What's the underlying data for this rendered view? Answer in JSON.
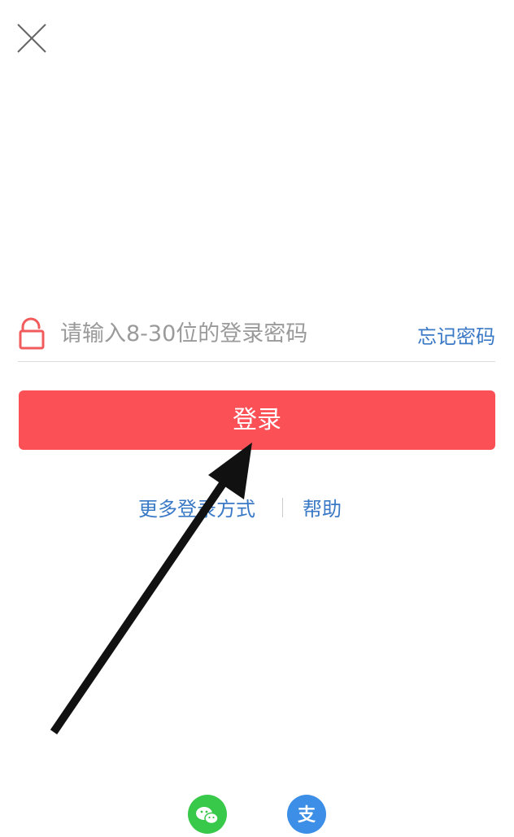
{
  "header": {
    "close_icon": "close-icon"
  },
  "password": {
    "lock_icon": "lock-icon",
    "placeholder": "请输入8-30位的登录密码",
    "value": "",
    "forgot_label": "忘记密码"
  },
  "login_button": {
    "label": "登录"
  },
  "links": {
    "more_methods": "更多登录方式",
    "help": "帮助"
  },
  "third_party": {
    "wechat_icon": "wechat-icon",
    "alipay_icon": "alipay-icon",
    "alipay_glyph": "支"
  },
  "colors": {
    "accent": "#fc5057",
    "link": "#3a79c6",
    "lock": "#f25b5b",
    "wechat": "#38c84a",
    "alipay": "#3d8ee6",
    "arrow": "#111111"
  }
}
